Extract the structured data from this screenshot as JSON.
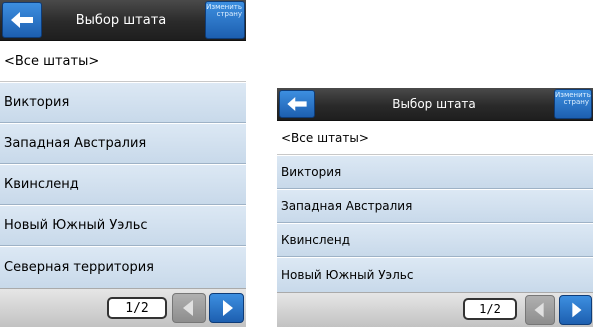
{
  "screens": [
    {
      "title": "Выбор штата",
      "change_country_label": "Изменить страну",
      "items": [
        {
          "label": "<Все штаты>"
        },
        {
          "label": "Виктория"
        },
        {
          "label": "Западная Австралия"
        },
        {
          "label": "Квинсленд"
        },
        {
          "label": "Новый Южный Уэльс"
        },
        {
          "label": "Северная территория"
        }
      ],
      "page_indicator": "1/2"
    },
    {
      "title": "Выбор штата",
      "change_country_label": "Изменить страну",
      "items": [
        {
          "label": "<Все штаты>"
        },
        {
          "label": "Виктория"
        },
        {
          "label": "Западная Австралия"
        },
        {
          "label": "Квинсленд"
        },
        {
          "label": "Новый Южный Уэльс"
        }
      ],
      "page_indicator": "1/2"
    }
  ],
  "colors": {
    "titlebar": "#2a2a2a",
    "accent_blue": "#1d5fb0",
    "list_item": "#d0dfee",
    "selected_item": "#ffffff",
    "footer": "#d0d0d0"
  },
  "icons": {
    "back": "arrow-left-icon",
    "prev": "chevron-left-icon",
    "next": "chevron-right-icon"
  }
}
